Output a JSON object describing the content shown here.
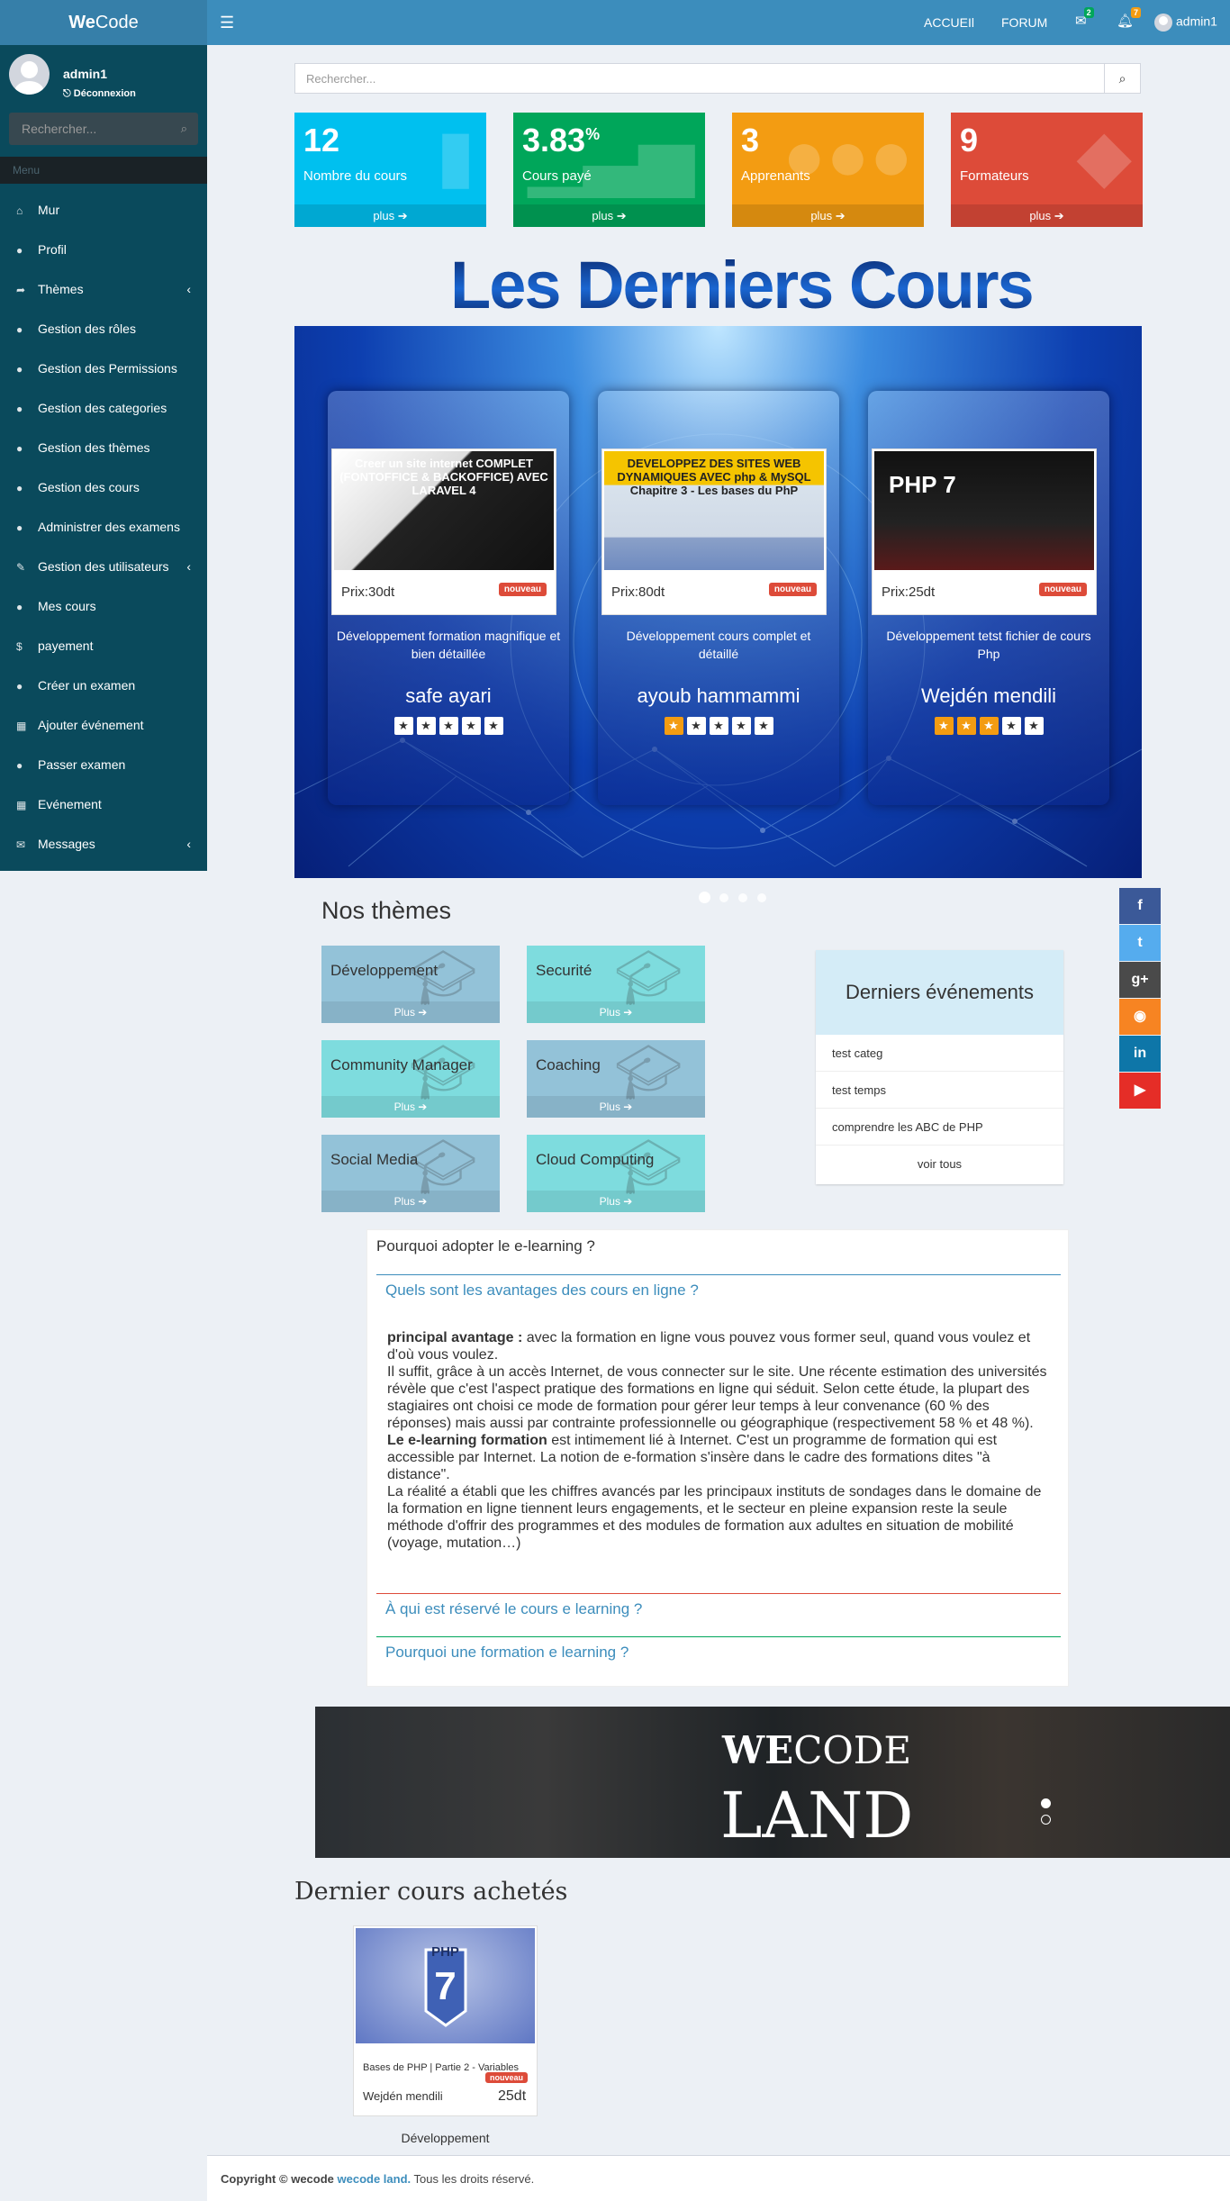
{
  "app": {
    "logo_bold": "We",
    "logo_rest": "Code"
  },
  "nav": {
    "accueil": "ACCUEIl",
    "forum": "FORUM",
    "messages_count": "2",
    "notif_count": "7",
    "user": "admin1"
  },
  "user": {
    "name": "admin1",
    "logout": "Déconnexion"
  },
  "sidebar": {
    "search_placeholder": "Rechercher...",
    "menu_header": "Menu",
    "items": [
      {
        "label": "Mur",
        "icon": "home-icon",
        "glyph": "⌂"
      },
      {
        "label": "Profil",
        "icon": "user-icon",
        "glyph": "●"
      },
      {
        "label": "Thèmes",
        "icon": "share-icon",
        "glyph": "➦"
      },
      {
        "label": "Gestion des rôles",
        "icon": "user-icon",
        "glyph": "●"
      },
      {
        "label": "Gestion des Permissions",
        "icon": "user-icon",
        "glyph": "●"
      },
      {
        "label": "Gestion des categories",
        "icon": "user-icon",
        "glyph": "●"
      },
      {
        "label": "Gestion des thèmes",
        "icon": "user-icon",
        "glyph": "●"
      },
      {
        "label": "Gestion des cours",
        "icon": "user-icon",
        "glyph": "●"
      },
      {
        "label": "Administrer des examens",
        "icon": "user-icon",
        "glyph": "●"
      },
      {
        "label": "Gestion des utilisateurs",
        "icon": "edit-icon",
        "glyph": "✎"
      },
      {
        "label": "Mes cours",
        "icon": "user-icon",
        "glyph": "●"
      },
      {
        "label": "payement",
        "icon": "dollar-icon",
        "glyph": "$"
      },
      {
        "label": "Créer un examen",
        "icon": "circle-icon",
        "glyph": "●"
      },
      {
        "label": "Ajouter événement",
        "icon": "calendar-icon",
        "glyph": "▦"
      },
      {
        "label": "Passer examen",
        "icon": "circle-icon",
        "glyph": "●"
      },
      {
        "label": "Evénement",
        "icon": "calendar-icon",
        "glyph": "▦"
      },
      {
        "label": "Messages",
        "icon": "envelope-icon",
        "glyph": "✉"
      }
    ]
  },
  "search": {
    "placeholder": "Rechercher..."
  },
  "stats": [
    {
      "value": "12",
      "sup": "",
      "label": "Nombre du cours",
      "more": "plus ➔",
      "color": "#00c0ef",
      "icon": "book-icon",
      "glyph": "▮"
    },
    {
      "value": "3.83",
      "sup": "%",
      "label": "Cours payé",
      "more": "plus ➔",
      "color": "#00a65a",
      "icon": "bar-chart-icon",
      "glyph": "▁▃▅"
    },
    {
      "value": "3",
      "sup": "",
      "label": "Apprenants",
      "more": "plus ➔",
      "color": "#f39c12",
      "icon": "users-icon",
      "glyph": "●●●"
    },
    {
      "value": "9",
      "sup": "",
      "label": "Formateurs",
      "more": "plus ➔",
      "color": "#dd4b39",
      "icon": "spy-icon",
      "glyph": "◆"
    }
  ],
  "latest_title": "Les Derniers Cours",
  "courses": [
    {
      "img_text": "Creer un site internet COMPLET (FONTOFFICE & BACKOFFICE) AVEC LARAVEL 4",
      "price": "Prix:30dt",
      "badge": "nouveau",
      "desc": "Développement formation magnifique et bien détaillée",
      "author": "safe ayari",
      "rating": 0
    },
    {
      "img_text": "DEVELOPPEZ DES SITES WEB DYNAMIQUES AVEC php & MySQL Chapitre 3 - Les bases du PhP",
      "price": "Prix:80dt",
      "badge": "nouveau",
      "desc": "Développement cours complet et détaillé",
      "author": "ayoub hammammi",
      "rating": 1
    },
    {
      "img_text": "PHP 7",
      "price": "Prix:25dt",
      "badge": "nouveau",
      "desc": "Développement tetst fichier de cours Php",
      "author": "Wejdén mendili",
      "rating": 3
    }
  ],
  "themes_title": "Nos thèmes",
  "themes": [
    {
      "name": "Développement",
      "more": "Plus ➔"
    },
    {
      "name": "Securité",
      "more": "Plus ➔"
    },
    {
      "name": "Community Manager",
      "more": "Plus ➔"
    },
    {
      "name": "Coaching",
      "more": "Plus ➔"
    },
    {
      "name": "Social Media",
      "more": "Plus ➔"
    },
    {
      "name": "Cloud Computing",
      "more": "Plus ➔"
    }
  ],
  "events": {
    "title": "Derniers événements",
    "items": [
      "test categ",
      "test temps",
      "comprendre les ABC de PHP"
    ],
    "all": "voir tous"
  },
  "social": [
    {
      "name": "facebook-icon",
      "glyph": "f",
      "color": "#3b5998"
    },
    {
      "name": "twitter-icon",
      "glyph": "t",
      "color": "#55acee"
    },
    {
      "name": "google-plus-icon",
      "glyph": "g+",
      "color": "#4a4a4a"
    },
    {
      "name": "rss-icon",
      "glyph": "◉",
      "color": "#f78422"
    },
    {
      "name": "linkedin-icon",
      "glyph": "in",
      "color": "#0e76a8"
    },
    {
      "name": "youtube-icon",
      "glyph": "▶",
      "color": "#e52d27"
    }
  ],
  "faq": {
    "title": "Pourquoi adopter le e-learning ?",
    "q1": "Quels sont les avantages des cours en ligne ?",
    "a_b1": "principal avantage :",
    "a_t1": " avec la formation en ligne vous pouvez vous former seul, quand vous voulez et d'où vous voulez.",
    "a_t2": "Il suffit, grâce à un accès Internet, de vous connecter sur le site. Une récente estimation des universités révèle que c'est l'aspect pratique des formations en ligne qui séduit. Selon cette étude, la plupart des stagiaires ont choisi ce mode de formation pour gérer leur temps à leur convenance (60 % des réponses) mais aussi par contrainte professionnelle ou géographique (respectivement 58 % et 48 %).",
    "a_b2": "Le e-learning formation",
    "a_t3": " est intimement lié à Internet. C'est un programme de formation qui est accessible par Internet. La notion de e-formation s'insère dans le cadre des formations dites \"à distance\".",
    "a_t4": "La réalité a établi que les chiffres avancés par les principaux instituts de sondages dans le domaine de la formation en ligne tiennent leurs engagements, et le secteur en pleine expansion reste la seule méthode d'offrir des programmes et des modules de formation aux adultes en situation de mobilité (voyage, mutation…)",
    "q2": "À qui est réservé le cours e learning ?",
    "q3": "Pourquoi une formation e learning ?"
  },
  "banner": {
    "line1_bold": "WE",
    "line1_rest": "CODE",
    "line2": "LAND"
  },
  "purchased": {
    "title": "Dernier cours achetés",
    "img_text": "PHP",
    "img_num": "7",
    "course": "Bases de PHP | Partie 2 - Variables",
    "badge": "nouveau",
    "author": "Wejdén mendili",
    "price": "25dt",
    "category": "Développement"
  },
  "footer": {
    "copy": "Copyright ©",
    "brand1": "wecode",
    "brand2": "wecode land.",
    "rights": " Tous les droits réservé."
  }
}
